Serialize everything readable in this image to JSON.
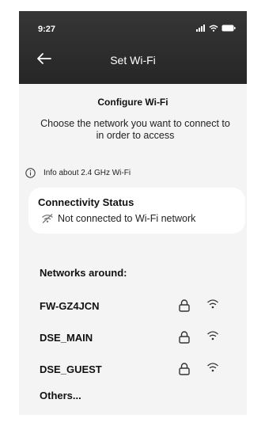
{
  "status_bar": {
    "time": "9:27"
  },
  "header": {
    "title": "Set Wi-Fi"
  },
  "configure": {
    "title": "Configure Wi-Fi",
    "description_line1": "Choose the network you want to connect to",
    "description_line2": "in order to access"
  },
  "info": {
    "label": "Info about 2.4 GHz Wi-Fi"
  },
  "connectivity": {
    "title": "Connectivity Status",
    "status": "Not connected to Wi-Fi network"
  },
  "networks": {
    "title": "Networks around:",
    "items": [
      {
        "name": "FW-GZ4JCN",
        "secured": true
      },
      {
        "name": "DSE_MAIN",
        "secured": true
      },
      {
        "name": "DSE_GUEST",
        "secured": true
      }
    ],
    "others_label": "Others..."
  },
  "colors": {
    "header_bg": "#2e2e2e",
    "screen_bg": "#f4f4f4",
    "card_bg": "#ffffff"
  },
  "icons": [
    "back-arrow-icon",
    "signal-icon",
    "wifi-icon",
    "battery-icon",
    "info-icon",
    "wifi-off-icon",
    "lock-icon"
  ]
}
